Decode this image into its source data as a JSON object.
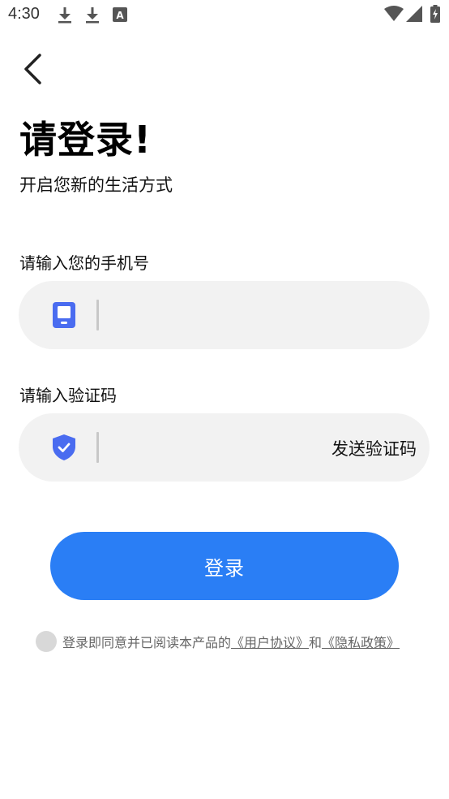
{
  "status_bar": {
    "time": "4:30",
    "icons": [
      "download-icon",
      "download-icon",
      "font-notification-icon",
      "wifi-icon",
      "signal-icon",
      "battery-charging-icon"
    ]
  },
  "header": {
    "title": "请登录!",
    "subtitle": "开启您新的生活方式"
  },
  "phone_field": {
    "label": "请输入您的手机号",
    "value": "",
    "icon": "phone-icon",
    "icon_color": "#4a6cf0"
  },
  "code_field": {
    "label": "请输入验证码",
    "value": "",
    "icon": "shield-check-icon",
    "icon_color": "#4a6cf0",
    "send_code_label": "发送验证码"
  },
  "login_button": {
    "label": "登录",
    "color": "#2a7ef5"
  },
  "agreement": {
    "text": "登录即同意并已阅读本产品的",
    "user_agreement": "《用户协议》",
    "conjunction": "和",
    "privacy_policy": "《隐私政策》",
    "checked": false
  }
}
